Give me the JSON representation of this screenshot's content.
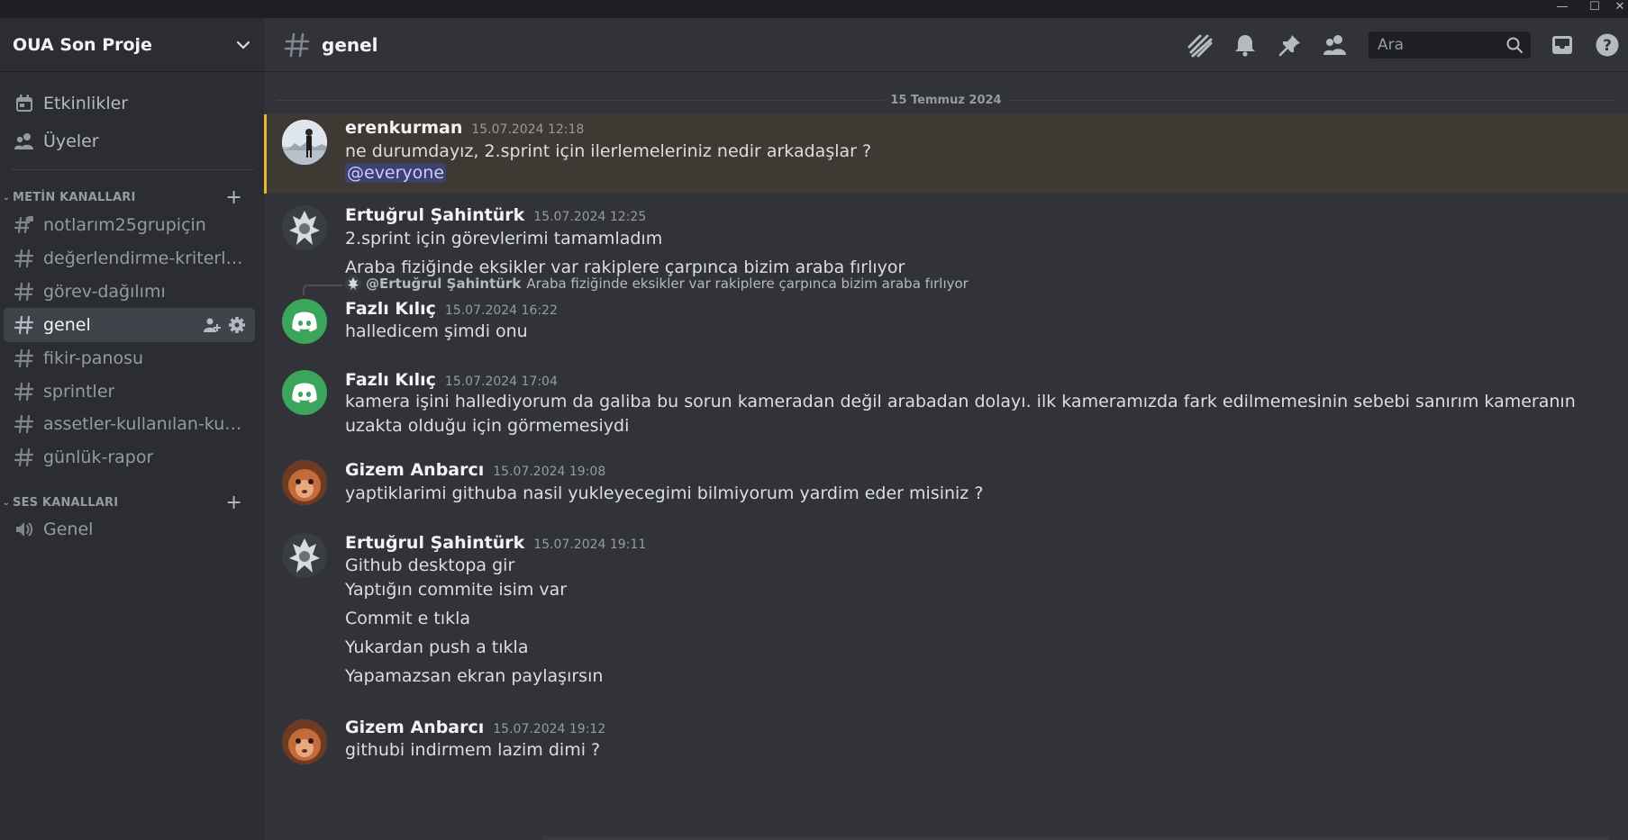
{
  "window": {
    "minimize": "—",
    "maximize": "☐",
    "close": "✕"
  },
  "server": {
    "name": "OUA Son Proje"
  },
  "sidebar": {
    "top_items": [
      {
        "label": "Etkinlikler",
        "icon": "calendar-icon"
      },
      {
        "label": "Üyeler",
        "icon": "members-icon"
      }
    ],
    "text_category": "METİN KANALLARI",
    "text_channels": [
      {
        "label": "notlarım25grupiçin",
        "icon": "locked-hash-icon"
      },
      {
        "label": "değerlendirme-kriterleri",
        "icon": "hash-icon"
      },
      {
        "label": "görev-dağılımı",
        "icon": "hash-icon"
      },
      {
        "label": "genel",
        "icon": "hash-icon",
        "active": true
      },
      {
        "label": "fikir-panosu",
        "icon": "hash-icon"
      },
      {
        "label": "sprintler",
        "icon": "hash-icon"
      },
      {
        "label": "assetler-kullanılan-kullanılmayan",
        "icon": "hash-icon"
      },
      {
        "label": "günlük-rapor",
        "icon": "hash-icon"
      }
    ],
    "voice_category": "SES KANALLARI",
    "voice_channels": [
      {
        "label": "Genel",
        "icon": "speaker-icon"
      }
    ]
  },
  "header": {
    "channel": "genel",
    "search_placeholder": "Ara",
    "icons": [
      "threads-icon",
      "bell-icon",
      "pin-icon",
      "members-icon",
      "search-icon",
      "inbox-icon",
      "help-icon"
    ]
  },
  "chat": {
    "date_divider": "15 Temmuz 2024",
    "messages": [
      {
        "author": "erenkurman",
        "time": "15.07.2024 12:18",
        "lines": [
          "ne durumdayız, 2.sprint için ilerlemeleriniz nedir arkadaşlar ?"
        ],
        "mention": "@everyone"
      },
      {
        "author": "Ertuğrul Şahintürk",
        "time": "15.07.2024 12:25",
        "lines": [
          "2.sprint için görevlerimi tamamladım",
          "Araba fiziğinde eksikler var rakiplere çarpınca bizim araba fırlıyor"
        ]
      },
      {
        "reply_to": "@Ertuğrul Şahintürk",
        "reply_text": "Araba fiziğinde eksikler var rakiplere çarpınca bizim araba fırlıyor",
        "author": "Fazlı Kılıç",
        "time": "15.07.2024 16:22",
        "lines": [
          "halledicem şimdi onu"
        ]
      },
      {
        "author": "Fazlı Kılıç",
        "time": "15.07.2024 17:04",
        "text": "kamera işini hallediyorum da galiba bu sorun kameradan değil arabadan dolayı. ilk kameramızda fark edilmemesinin sebebi sanırım kameranın uzakta olduğu için görmemesiydi"
      },
      {
        "author": "Gizem Anbarcı",
        "time": "15.07.2024 19:08",
        "lines": [
          "yaptiklarimi githuba nasil yukleyecegimi bilmiyorum yardim eder misiniz ?"
        ]
      },
      {
        "author": "Ertuğrul Şahintürk",
        "time": "15.07.2024 19:11",
        "lines": [
          "Github desktopa gir",
          "Yaptığın commite isim var",
          "Commit e tıkla",
          "Yukardan push a tıkla",
          "Yapamazsan ekran paylaşırsın"
        ]
      },
      {
        "author": "Gizem Anbarcı",
        "time": "15.07.2024 19:12",
        "lines": [
          "githubi indirmem lazim dimi ?"
        ]
      }
    ]
  },
  "colors": {
    "bg": "#313338",
    "sidebar": "#2b2d31",
    "titlebar": "#1e1f22",
    "active_channel": "#404249",
    "mention_bg": "#3e3a33",
    "mention_bar": "#f0b232",
    "discord_green": "#3ba55c",
    "mention_pill": "#3c4270"
  }
}
